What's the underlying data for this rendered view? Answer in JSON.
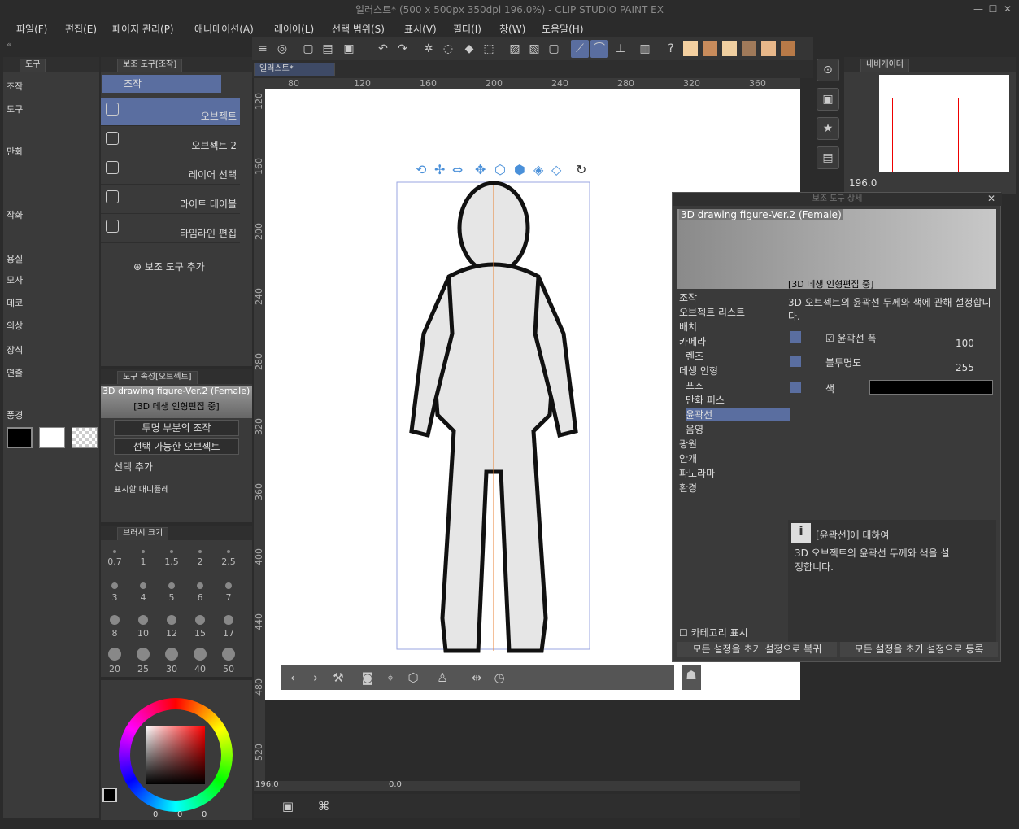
{
  "title": "일러스트* (500 x 500px 350dpi 196.0%)  - CLIP STUDIO PAINT EX",
  "menu": [
    "파일(F)",
    "편집(E)",
    "페이지 관리(P)",
    "애니메이션(A)",
    "레이어(L)",
    "선택 범위(S)",
    "표시(V)",
    "필터(I)",
    "창(W)",
    "도움말(H)"
  ],
  "tools_panel": {
    "tab": "도구",
    "categories": [
      "조작",
      "도구",
      "만화",
      "작화",
      "용실",
      "모사",
      "데코",
      "의상",
      "장식",
      "연출",
      "풍경"
    ]
  },
  "subtool_panel": {
    "tab": "보조 도구[조작]",
    "group": "조작",
    "items": [
      "오브젝트",
      "오브젝트 2",
      "레이어 선택",
      "라이트 테이블",
      "타임라인 편집"
    ],
    "add": "보조 도구 추가"
  },
  "tool_prop": {
    "tab": "도구 속성[오브젝트]",
    "model": "3D drawing figure-Ver.2 (Female)",
    "status": "[3D 데생 인형편집 중]",
    "dropdown1": "투명 부분의 조작",
    "dropdown2": "선택 가능한 오브젝트",
    "add_label": "선택 추가",
    "manip_label": "표시할 매니퓰레"
  },
  "brush_panel": {
    "tab": "브러시 크기",
    "sizes": [
      "0.7",
      "1",
      "1.5",
      "2",
      "2.5",
      "3",
      "4",
      "5",
      "6",
      "7",
      "8",
      "10",
      "12",
      "15",
      "17",
      "20",
      "25",
      "30",
      "40",
      "50"
    ]
  },
  "color_panel": {
    "values": [
      "0",
      "0",
      "0"
    ]
  },
  "canvas": {
    "tab": "일러스트*",
    "ruler_h": [
      "80",
      "120",
      "160",
      "200",
      "240",
      "280",
      "320",
      "360"
    ],
    "ruler_v": [
      "120",
      "160",
      "200",
      "240",
      "280",
      "320",
      "360",
      "400",
      "440",
      "480",
      "520"
    ],
    "zoom": "196.0",
    "rotation": "0.0"
  },
  "navigator": {
    "tab": "내비게이터",
    "zoom": "196.0"
  },
  "detail": {
    "title": "보조 도구 상세",
    "model": "3D drawing figure-Ver.2 (Female)",
    "status": "[3D 데생 인형편집 중]",
    "categories": [
      "조작",
      "오브젝트 리스트",
      "배치",
      "카메라",
      "렌즈",
      "데생 인형",
      "포즈",
      "만화 퍼스",
      "윤곽선",
      "음영",
      "광원",
      "안개",
      "파노라마",
      "환경"
    ],
    "selected_category": "윤곽선",
    "desc": "3D 오브젝트의 윤곽선 두께와 색에 관해 설정합니다.",
    "prop1": "윤곽선 폭",
    "prop1_val": "100",
    "prop2": "불투명도",
    "prop2_val": "255",
    "prop3": "색",
    "help_title": "[윤곽선]에 대하여",
    "help_text": "3D 오브젝트의 윤곽선 두께와 색을 설정합니다.",
    "show_category": "카테고리 표시",
    "reset": "모든 설정을 초기 설정으로 복귀",
    "register": "모든 설정을 초기 설정으로 등록"
  },
  "swatches": [
    "#f4d0a0",
    "#c98c5c",
    "#f0cfa0",
    "#a07a5a",
    "#e8b88a",
    "#b87a48"
  ]
}
